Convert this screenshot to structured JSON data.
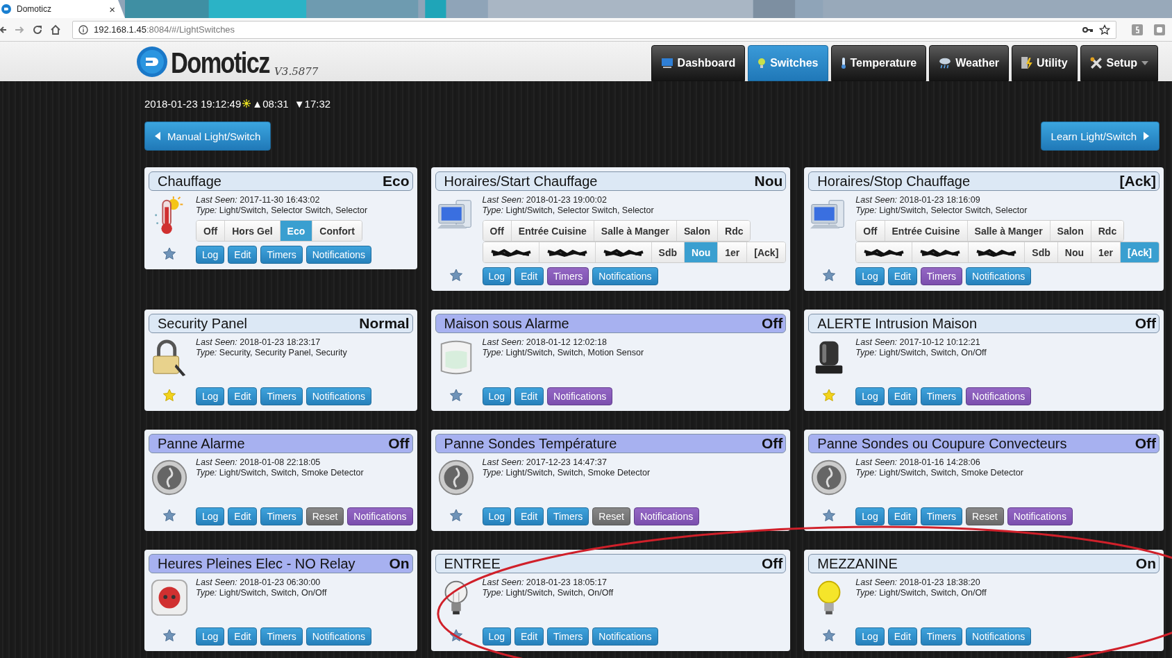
{
  "browser": {
    "tab": {
      "title": "Domoticz",
      "close": "×"
    },
    "url": {
      "host": "192.168.1.45",
      "rest": ":8084/#/LightSwitches"
    }
  },
  "app": {
    "name": "Domoticz",
    "version": "V3.5877"
  },
  "nav": [
    {
      "label": "Dashboard",
      "selected": false,
      "dropdown": false
    },
    {
      "label": "Switches",
      "selected": true,
      "dropdown": false
    },
    {
      "label": "Temperature",
      "selected": false,
      "dropdown": false
    },
    {
      "label": "Weather",
      "selected": false,
      "dropdown": false
    },
    {
      "label": "Utility",
      "selected": false,
      "dropdown": false
    },
    {
      "label": "Setup",
      "selected": false,
      "dropdown": true
    }
  ],
  "clock": {
    "datetime": "2018-01-23 19:12:49",
    "sunrise": "▲08:31",
    "sunset": "▼17:32"
  },
  "actions": {
    "left": "Manual Light/Switch",
    "right": "Learn Light/Switch"
  },
  "devices": [
    {
      "name": "Chauffage",
      "status": "Eco",
      "highlighted": false,
      "kind": "thermostat",
      "last_seen": "*Last Seen:* 2017-11-30 16:43:02",
      "type": "*Type:* Light/Switch, Selector Switch, Selector",
      "favorite": false,
      "selector": [
        [
          {
            "label": "Off",
            "selected": false
          },
          {
            "label": "Hors Gel",
            "selected": false
          },
          {
            "label": "Eco",
            "selected": true
          },
          {
            "label": "Confort",
            "selected": false
          }
        ]
      ],
      "buttons": [
        {
          "label": "Log",
          "kind": "plain"
        },
        {
          "label": "Edit",
          "kind": "plain"
        },
        {
          "label": "Timers",
          "kind": "plain"
        },
        {
          "label": "Notifications",
          "kind": "plain"
        }
      ]
    },
    {
      "name": "Horaires/Start Chauffage",
      "status": "Nou",
      "highlighted": false,
      "kind": "scheduler",
      "last_seen": "*Last Seen:* 2018-01-23 19:00:02",
      "type": "*Type:* Light/Switch, Selector Switch, Selector",
      "favorite": false,
      "selector": [
        [
          {
            "label": "Off",
            "selected": false
          },
          {
            "label": "Entrée Cuisine",
            "selected": false
          },
          {
            "label": "Salle à Manger",
            "selected": false
          },
          {
            "label": "Salon",
            "selected": false
          },
          {
            "label": "Rdc",
            "selected": false
          }
        ],
        [
          {
            "scribbled": true,
            "selected": false
          },
          {
            "scribbled": true,
            "selected": false
          },
          {
            "scribbled": true,
            "selected": false
          },
          {
            "label": "Sdb",
            "selected": false
          },
          {
            "label": "Nou",
            "selected": true
          },
          {
            "label": "1er",
            "selected": false
          },
          {
            "label": "[Ack]",
            "selected": false
          }
        ]
      ],
      "buttons": [
        {
          "label": "Log",
          "kind": "plain"
        },
        {
          "label": "Edit",
          "kind": "plain"
        },
        {
          "label": "Timers",
          "kind": "set"
        },
        {
          "label": "Notifications",
          "kind": "plain"
        }
      ]
    },
    {
      "name": "Horaires/Stop Chauffage",
      "status": "[Ack]",
      "highlighted": false,
      "kind": "scheduler",
      "last_seen": "*Last Seen:* 2018-01-23 18:16:09",
      "type": "*Type:* Light/Switch, Selector Switch, Selector",
      "favorite": false,
      "selector": [
        [
          {
            "label": "Off",
            "selected": false
          },
          {
            "label": "Entrée Cuisine",
            "selected": false
          },
          {
            "label": "Salle à Manger",
            "selected": false
          },
          {
            "label": "Salon",
            "selected": false
          },
          {
            "label": "Rdc",
            "selected": false
          }
        ],
        [
          {
            "scribbled": true,
            "selected": false
          },
          {
            "scribbled": true,
            "selected": false
          },
          {
            "scribbled": true,
            "selected": false
          },
          {
            "label": "Sdb",
            "selected": false
          },
          {
            "label": "Nou",
            "selected": false
          },
          {
            "label": "1er",
            "selected": false
          },
          {
            "label": "[Ack]",
            "selected": true
          }
        ]
      ],
      "buttons": [
        {
          "label": "Log",
          "kind": "plain"
        },
        {
          "label": "Edit",
          "kind": "plain"
        },
        {
          "label": "Timers",
          "kind": "set"
        },
        {
          "label": "Notifications",
          "kind": "plain"
        }
      ]
    },
    {
      "name": "Security Panel",
      "status": "Normal",
      "highlighted": false,
      "kind": "security",
      "last_seen": "*Last Seen:* 2018-01-23 18:23:17",
      "type": "*Type:* Security, Security Panel, Security",
      "favorite": true,
      "buttons": [
        {
          "label": "Log",
          "kind": "plain"
        },
        {
          "label": "Edit",
          "kind": "plain"
        },
        {
          "label": "Timers",
          "kind": "plain"
        },
        {
          "label": "Notifications",
          "kind": "plain"
        }
      ]
    },
    {
      "name": "Maison sous Alarme",
      "status": "Off",
      "highlighted": true,
      "kind": "motion",
      "last_seen": "*Last Seen:* 2018-01-12 12:02:18",
      "type": "*Type:* Light/Switch, Switch, Motion Sensor",
      "favorite": false,
      "buttons": [
        {
          "label": "Log",
          "kind": "plain"
        },
        {
          "label": "Edit",
          "kind": "plain"
        },
        {
          "label": "Notifications",
          "kind": "set"
        }
      ]
    },
    {
      "name": "ALERTE Intrusion Maison",
      "status": "Off",
      "highlighted": false,
      "kind": "siren",
      "last_seen": "*Last Seen:* 2017-10-12 10:12:21",
      "type": "*Type:* Light/Switch, Switch, On/Off",
      "favorite": true,
      "buttons": [
        {
          "label": "Log",
          "kind": "plain"
        },
        {
          "label": "Edit",
          "kind": "plain"
        },
        {
          "label": "Timers",
          "kind": "plain"
        },
        {
          "label": "Notifications",
          "kind": "set"
        }
      ]
    },
    {
      "name": "Panne Alarme",
      "status": "Off",
      "highlighted": true,
      "kind": "smoke",
      "last_seen": "*Last Seen:* 2018-01-08 22:18:05",
      "type": "*Type:* Light/Switch, Switch, Smoke Detector",
      "favorite": false,
      "buttons": [
        {
          "label": "Log",
          "kind": "plain"
        },
        {
          "label": "Edit",
          "kind": "plain"
        },
        {
          "label": "Timers",
          "kind": "plain"
        },
        {
          "label": "Reset",
          "kind": "reset"
        },
        {
          "label": "Notifications",
          "kind": "set"
        }
      ]
    },
    {
      "name": "Panne Sondes Température",
      "status": "Off",
      "highlighted": true,
      "kind": "smoke",
      "last_seen": "*Last Seen:* 2017-12-23 14:47:37",
      "type": "*Type:* Light/Switch, Switch, Smoke Detector",
      "favorite": false,
      "buttons": [
        {
          "label": "Log",
          "kind": "plain"
        },
        {
          "label": "Edit",
          "kind": "plain"
        },
        {
          "label": "Timers",
          "kind": "plain"
        },
        {
          "label": "Reset",
          "kind": "reset"
        },
        {
          "label": "Notifications",
          "kind": "set"
        }
      ]
    },
    {
      "name": "Panne Sondes ou Coupure Convecteurs",
      "status": "Off",
      "highlighted": true,
      "kind": "smoke",
      "last_seen": "*Last Seen:* 2018-01-16 14:28:06",
      "type": "*Type:* Light/Switch, Switch, Smoke Detector",
      "favorite": false,
      "buttons": [
        {
          "label": "Log",
          "kind": "plain"
        },
        {
          "label": "Edit",
          "kind": "plain"
        },
        {
          "label": "Timers",
          "kind": "plain"
        },
        {
          "label": "Reset",
          "kind": "reset"
        },
        {
          "label": "Notifications",
          "kind": "set"
        }
      ]
    },
    {
      "name": "Heures Pleines Elec - NO Relay",
      "status": "On",
      "highlighted": true,
      "kind": "socket",
      "last_seen": "*Last Seen:* 2018-01-23 06:30:00",
      "type": "*Type:* Light/Switch, Switch, On/Off",
      "favorite": false,
      "buttons": [
        {
          "label": "Log",
          "kind": "plain"
        },
        {
          "label": "Edit",
          "kind": "plain"
        },
        {
          "label": "Timers",
          "kind": "plain"
        },
        {
          "label": "Notifications",
          "kind": "plain"
        }
      ]
    },
    {
      "name": "ENTREE",
      "status": "Off",
      "highlighted": false,
      "kind": "light",
      "lit": false,
      "last_seen": "*Last Seen:* 2018-01-23 18:05:17",
      "type": "*Type:* Light/Switch, Switch, On/Off",
      "favorite": false,
      "buttons": [
        {
          "label": "Log",
          "kind": "plain"
        },
        {
          "label": "Edit",
          "kind": "plain"
        },
        {
          "label": "Timers",
          "kind": "plain"
        },
        {
          "label": "Notifications",
          "kind": "plain"
        }
      ]
    },
    {
      "name": "MEZZANINE",
      "status": "On",
      "highlighted": false,
      "kind": "light",
      "lit": true,
      "last_seen": "*Last Seen:* 2018-01-23 18:38:20",
      "type": "*Type:* Light/Switch, Switch, On/Off",
      "favorite": false,
      "buttons": [
        {
          "label": "Log",
          "kind": "plain"
        },
        {
          "label": "Edit",
          "kind": "plain"
        },
        {
          "label": "Timers",
          "kind": "plain"
        },
        {
          "label": "Notifications",
          "kind": "plain"
        }
      ]
    }
  ]
}
